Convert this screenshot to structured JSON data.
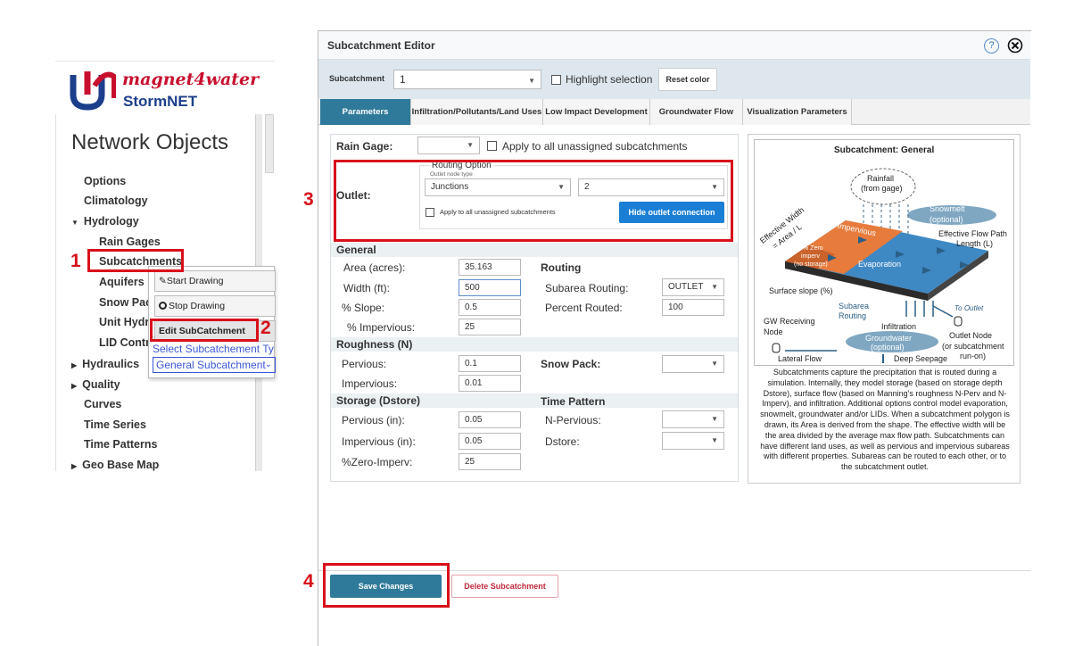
{
  "left_panel": {
    "brand": "magnet4water",
    "product": "StormNET",
    "title": "Network Objects",
    "nav": [
      "Options",
      "Climatology",
      "Hydrology",
      "Rain Gages",
      "Subcatchments",
      "Aquifers",
      "Snow Pacl",
      "Unit Hydro",
      "LID Contro",
      "Hydraulics",
      "Quality",
      "Curves",
      "Time Series",
      "Time Patterns",
      "Geo Base Map"
    ],
    "context_menu": {
      "start_drawing": "Start Drawing",
      "stop_drawing": "Stop Drawing",
      "edit_subcatchment": "Edit SubCatchment",
      "select_type_label": "Select Subcatchement Type",
      "select_type_value": "General Subcatchment"
    }
  },
  "annotations": [
    "1",
    "2",
    "3",
    "4"
  ],
  "editor": {
    "title": "Subcatchment Editor",
    "help_icon": "?",
    "close_icon": "close-circle",
    "toolbar": {
      "subcatchment_label": "Subcatchment",
      "subcatchment_value": "1",
      "highlight_label": "Highlight selection",
      "reset_color": "Reset color"
    },
    "tabs": [
      "Parameters",
      "Infiltration/Pollutants/Land Uses",
      "Low Impact Development",
      "Groundwater Flow",
      "Visualization Parameters"
    ],
    "rain_gage": {
      "label": "Rain Gage:",
      "value": "",
      "apply_label": "Apply to all unassigned subcatchments"
    },
    "outlet": {
      "label": "Outlet:",
      "routing_option": "Routing Option",
      "outlet_node_type_label": "Outlet node type",
      "node_type": "Junctions",
      "node_value": "2",
      "apply_label": "Apply to all unassigned subcatchments",
      "hide_button": "Hide outlet connection"
    },
    "general": {
      "header": "General",
      "area_label": "Area (acres):",
      "area": "35.163",
      "width_label": "Width (ft):",
      "width": "500",
      "slope_label": "% Slope:",
      "slope": "0.5",
      "imperv_label": "% Impervious:",
      "imperv": "25"
    },
    "routing": {
      "header": "Routing",
      "subarea_label": "Subarea Routing:",
      "subarea": "OUTLET",
      "routed_label": "Percent Routed:",
      "routed": "100"
    },
    "roughness": {
      "header": "Roughness (N)",
      "pervious_label": "Pervious:",
      "pervious": "0.1",
      "impervious_label": "Impervious:",
      "impervious": "0.01"
    },
    "snow_pack": {
      "label": "Snow Pack:",
      "value": ""
    },
    "storage": {
      "header": "Storage (Dstore)",
      "pervious_label": "Pervious (in):",
      "pervious": "0.05",
      "impervious_label": "Impervious (in):",
      "impervious": "0.05",
      "zero_label": "%Zero-Imperv:",
      "zero": "25"
    },
    "time_pattern": {
      "header": "Time Pattern",
      "nperv_label": "N-Pervious:",
      "nperv": "",
      "dstore_label": "Dstore:",
      "dstore": ""
    },
    "diagram": {
      "title": "Subcatchment: General",
      "rainfall": "Rainfall",
      "from_gage": "(from gage)",
      "snowmelt": "Snowmelt",
      "optional": "(optional)",
      "effective_width_1": "Effective Width",
      "effective_width_2": "= Area / L",
      "effective_flow_1": "Effective Flow Path",
      "effective_flow_2": "Length (L)",
      "pct_impervious": "% Impervious",
      "zero_imperv": "% Zero",
      "zero_imperv_2": "imperv",
      "zero_imperv_3": "(no storage)",
      "evaporation": "Evaporation",
      "surface_slope": "Surface slope (%)",
      "to_outlet": "To Outlet",
      "subarea_routing_1": "Subarea",
      "subarea_routing_2": "Routing",
      "gw_receiving_1": "GW Receiving",
      "gw_receiving_2": "Node",
      "infiltration": "Infiltration",
      "outlet_node": "Outlet Node",
      "outlet_node_2": "(or subcatchment",
      "outlet_node_3": "run-on)",
      "groundwater": "Groundwater",
      "lateral_flow": "Lateral Flow",
      "deep_seepage": "Deep Seepage",
      "description": "Subcatchments capture the precipitation that is routed during a simulation. Internally, they model storage (based on storage depth Dstore), surface flow (based on Manning's roughness N-Perv and N-Imperv), and infiltration. Additional options control model evaporation, snowmelt, groundwater and/or LIDs. When a subcatchment polygon is drawn, its Area is derived from the shape. The effective width will be the area divided by the average max flow path. Subcatchments can have different land uses, as well as pervious and impervious subareas with different properties. Subareas can be routed to each other, or to the subcatchment outlet."
    },
    "footer": {
      "save": "Save Changes",
      "delete": "Delete Subcatchment"
    }
  }
}
